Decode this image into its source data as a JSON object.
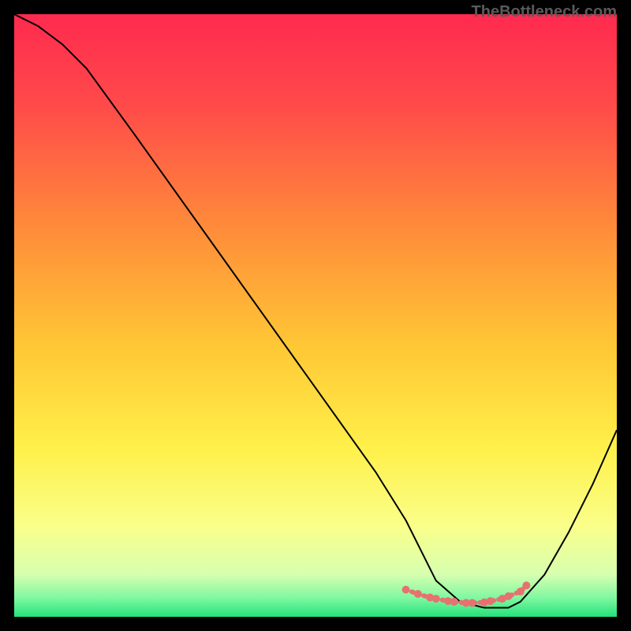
{
  "watermark": "TheBottleneck.com",
  "chart_data": {
    "type": "line",
    "title": "",
    "xlabel": "",
    "ylabel": "",
    "xlim": [
      0,
      100
    ],
    "ylim": [
      0,
      100
    ],
    "background_gradient": {
      "type": "vertical",
      "stops": [
        {
          "offset": 0.0,
          "color": "#ff2a4f"
        },
        {
          "offset": 0.15,
          "color": "#ff4a4a"
        },
        {
          "offset": 0.35,
          "color": "#ff8a3a"
        },
        {
          "offset": 0.55,
          "color": "#ffc735"
        },
        {
          "offset": 0.72,
          "color": "#fff04a"
        },
        {
          "offset": 0.85,
          "color": "#faff8a"
        },
        {
          "offset": 0.93,
          "color": "#d7ffb0"
        },
        {
          "offset": 0.97,
          "color": "#7cf7a0"
        },
        {
          "offset": 1.0,
          "color": "#23e27a"
        }
      ]
    },
    "series": [
      {
        "name": "bottleneck-curve",
        "color": "#000000",
        "stroke_width": 2,
        "x": [
          0,
          4,
          8,
          12,
          20,
          30,
          40,
          50,
          60,
          65,
          68,
          70,
          74,
          78,
          82,
          84,
          88,
          92,
          96,
          100
        ],
        "y": [
          100,
          98,
          95,
          91,
          80,
          66,
          52,
          38,
          24,
          16,
          10,
          6,
          2.5,
          1.5,
          1.5,
          2.5,
          7,
          14,
          22,
          31
        ]
      }
    ],
    "markers": {
      "name": "optimal-region",
      "color": "#e6726f",
      "radius": 5,
      "x": [
        65,
        67,
        69,
        70,
        72,
        73,
        75,
        76,
        78,
        79,
        81,
        82,
        84,
        85
      ],
      "y": [
        4.5,
        3.8,
        3.2,
        3.0,
        2.6,
        2.5,
        2.3,
        2.3,
        2.4,
        2.6,
        3.0,
        3.4,
        4.2,
        5.2
      ]
    }
  }
}
